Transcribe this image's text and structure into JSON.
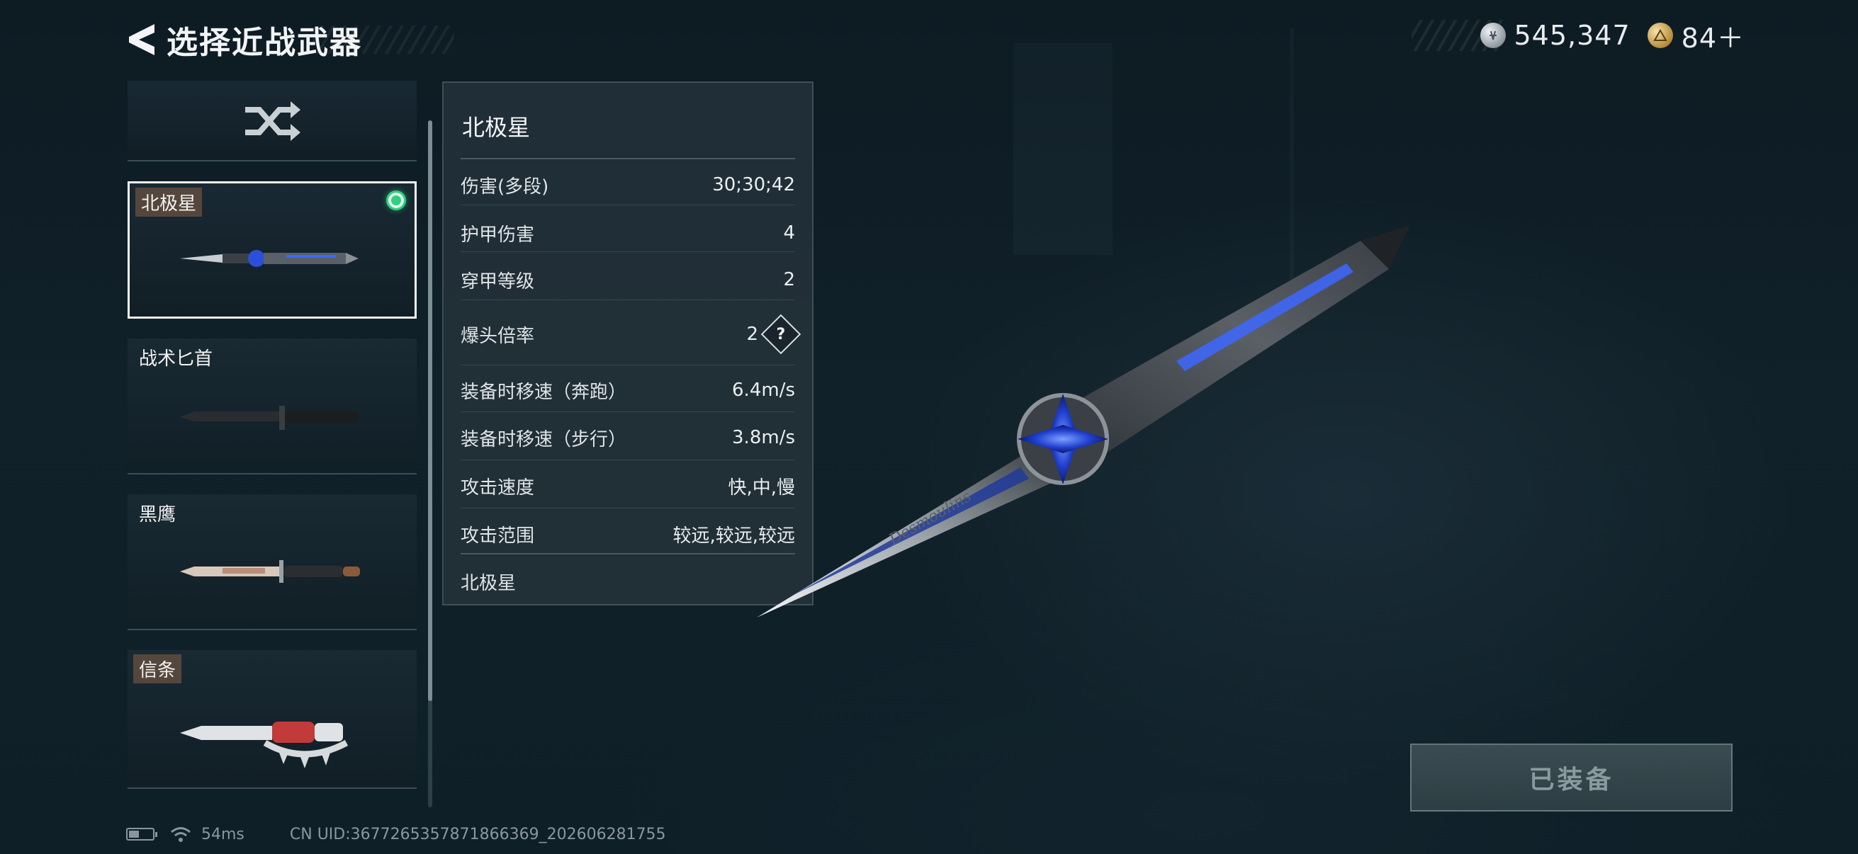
{
  "header": {
    "title": "选择近战武器",
    "back_icon": "back-arrow-icon"
  },
  "currency": [
    {
      "icon": "silver-coin-icon",
      "value": "545,347"
    },
    {
      "icon": "gold-coin-icon",
      "value": "84＋"
    }
  ],
  "weapon_list": {
    "random_icon": "shuffle-icon",
    "items": [
      {
        "name": "北极星",
        "selected": true,
        "equipped": true,
        "tag": true
      },
      {
        "name": "战术匕首",
        "selected": false,
        "equipped": false,
        "tag": false
      },
      {
        "name": "黑鹰",
        "selected": false,
        "equipped": false,
        "tag": false
      },
      {
        "name": "信条",
        "selected": false,
        "equipped": false,
        "tag": true
      }
    ]
  },
  "stats": {
    "title": "北极星",
    "rows": [
      {
        "label": "伤害(多段)",
        "value": "30;30;42"
      },
      {
        "label": "护甲伤害",
        "value": "4"
      },
      {
        "label": "穿甲等级",
        "value": "2"
      },
      {
        "label": "爆头倍率",
        "value": "2",
        "help": "?"
      },
      {
        "label": "装备时移速（奔跑）",
        "value": "6.4m/s"
      },
      {
        "label": "装备时移速（步行）",
        "value": "3.8m/s"
      },
      {
        "label": "攻击速度",
        "value": "快,中,慢"
      },
      {
        "label": "攻击范围",
        "value": "较远,较远,较远"
      }
    ],
    "footer": "北极星"
  },
  "weapon_engraving": "Desmoulins",
  "equip_button": {
    "label": "已装备"
  },
  "status_bar": {
    "battery_level": 0.45,
    "ping": "54ms",
    "uid": "CN UID:3677265357871866369_202606281755"
  },
  "colors": {
    "equipped": "#2fd07e",
    "blade_accent": "#2b4fd8"
  }
}
